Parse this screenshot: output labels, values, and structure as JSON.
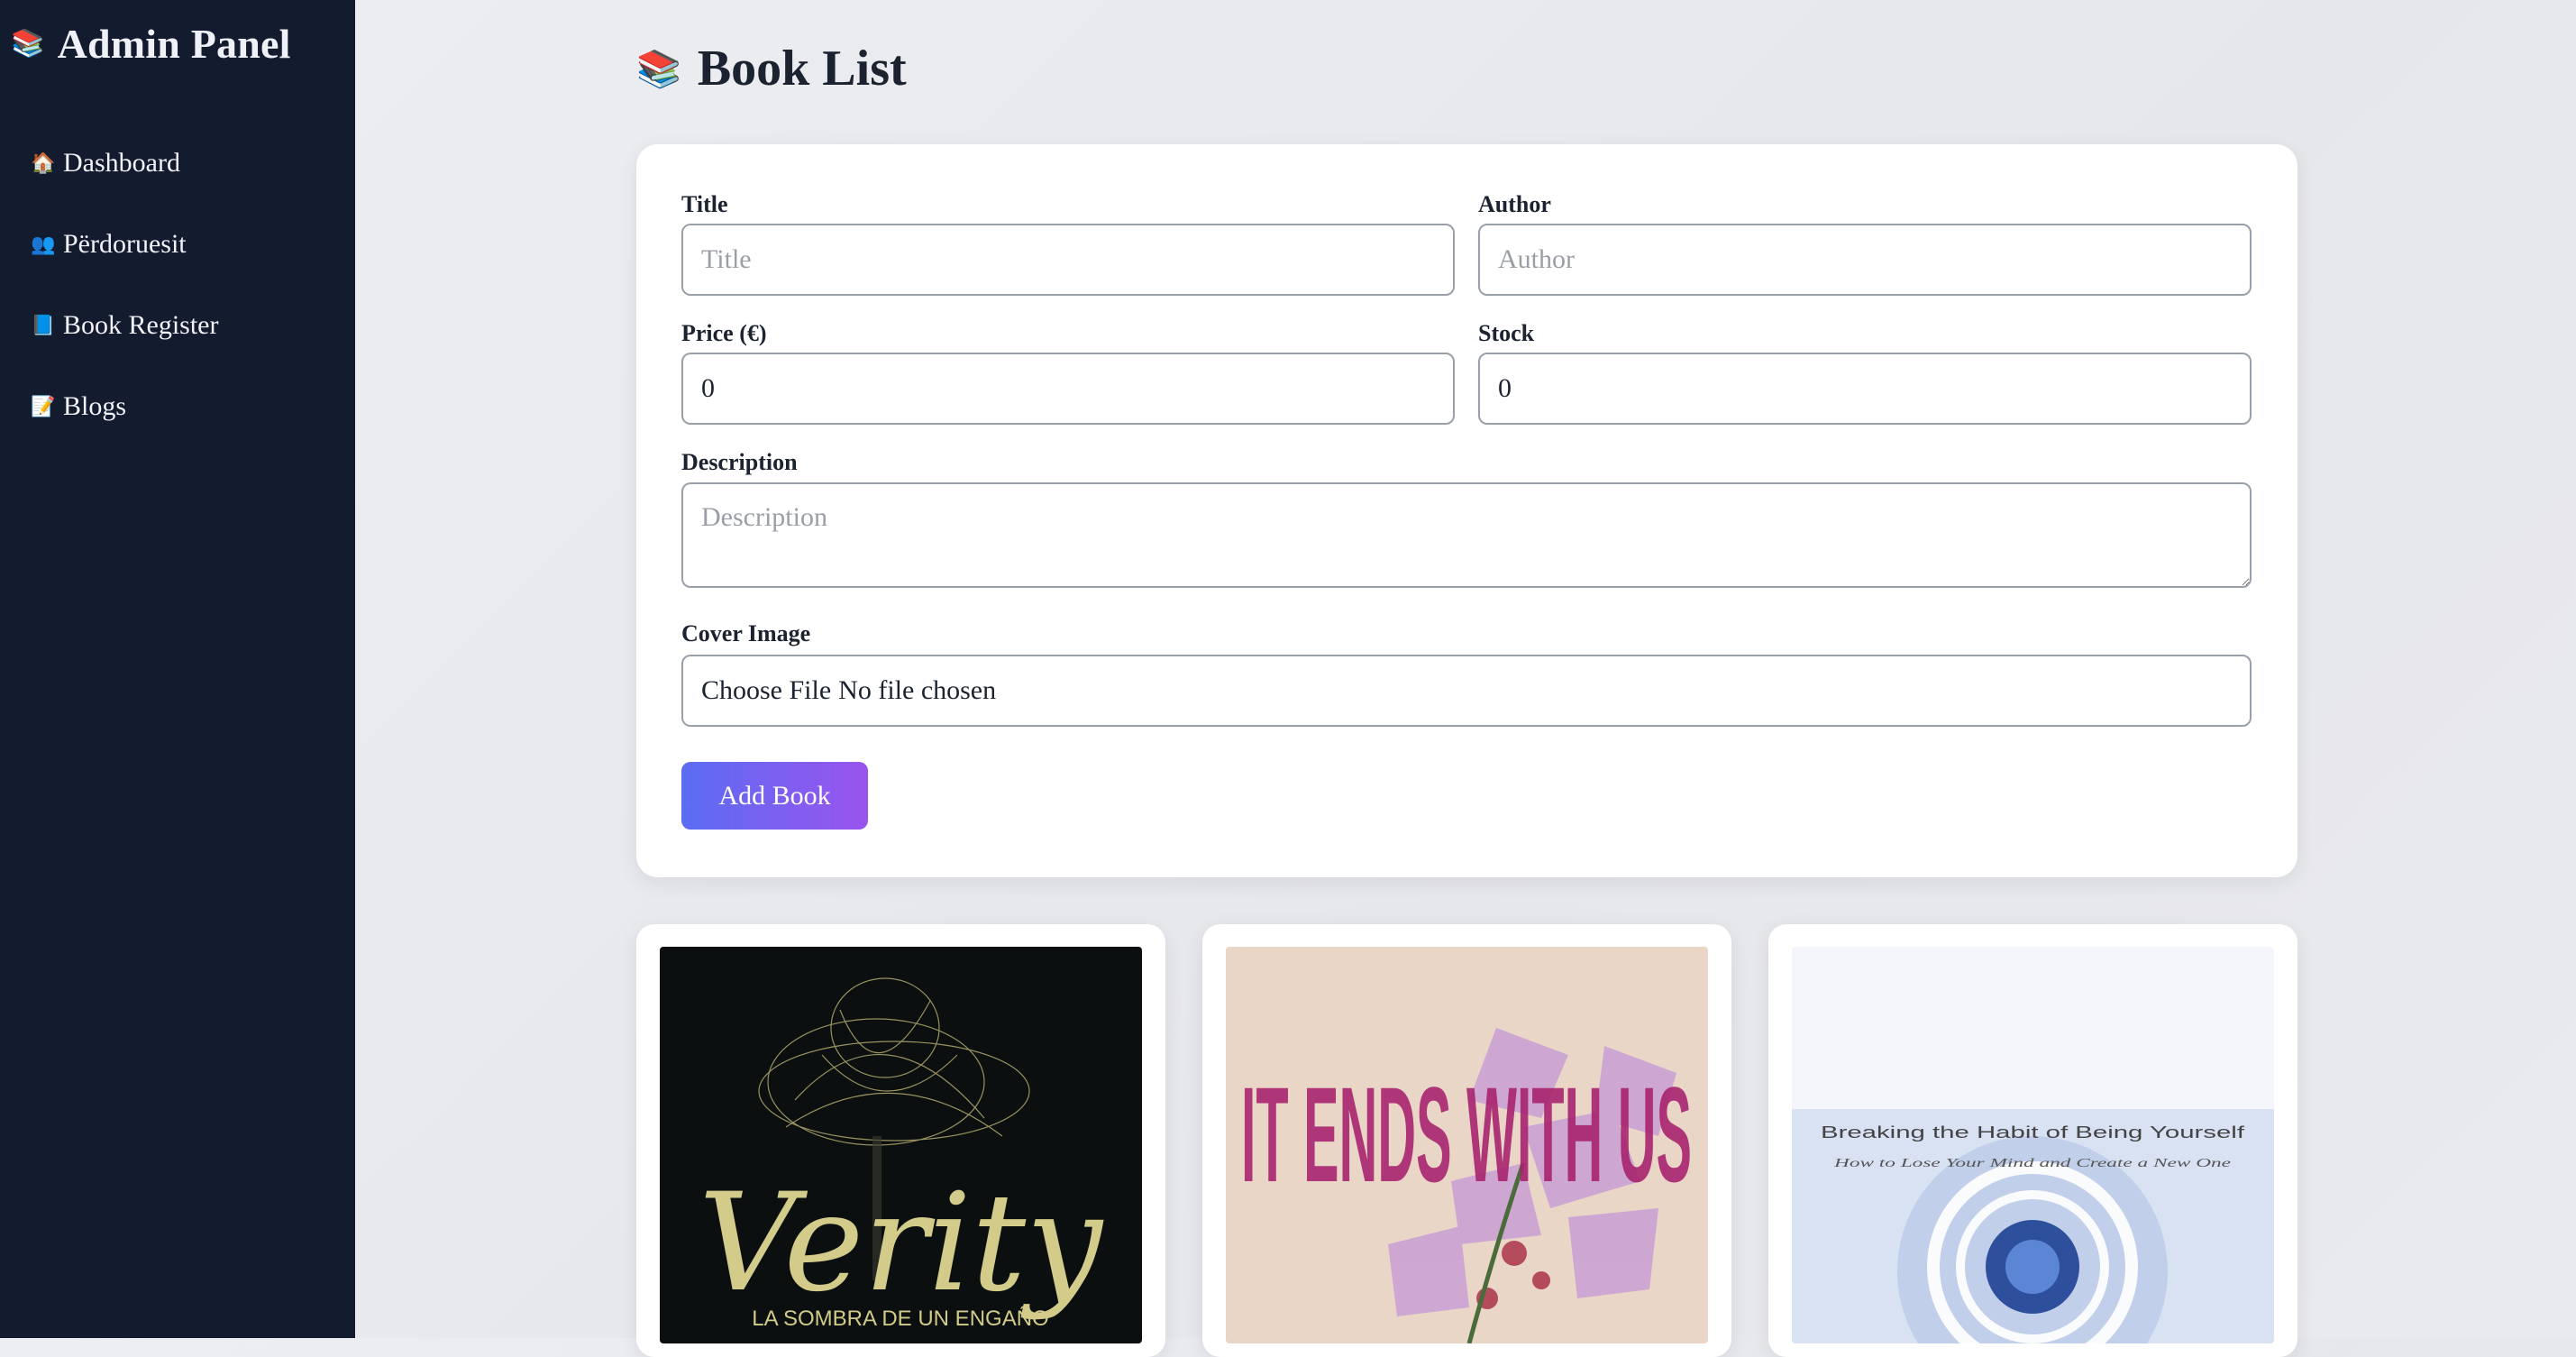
{
  "sidebar": {
    "brand_icon": "📚",
    "brand": "Admin Panel",
    "items": [
      {
        "icon": "🏠",
        "icon_name": "house-icon",
        "label": "Dashboard"
      },
      {
        "icon": "👥",
        "icon_name": "users-icon",
        "label": "Përdoruesit"
      },
      {
        "icon": "📘",
        "icon_name": "book-icon",
        "label": "Book Register"
      },
      {
        "icon": "📝",
        "icon_name": "memo-icon",
        "label": "Blogs"
      }
    ]
  },
  "page": {
    "title_icon": "📚",
    "title": "Book List"
  },
  "form": {
    "title_label": "Title",
    "title_placeholder": "Title",
    "author_label": "Author",
    "author_placeholder": "Author",
    "price_label": "Price (€)",
    "price_value": "0",
    "stock_label": "Stock",
    "stock_value": "0",
    "description_label": "Description",
    "description_placeholder": "Description",
    "cover_label": "Cover Image",
    "cover_button": "Choose File",
    "cover_status": "No file chosen",
    "submit_label": "Add Book"
  },
  "books": [
    {
      "cover_title": "Verity",
      "cover_subtitle": "LA SOMBRA DE UN ENGAÑO"
    },
    {
      "cover_title": "IT ENDS WITH US"
    },
    {
      "cover_title": "Breaking the Habit of Being Yourself",
      "cover_subtitle": "How to Lose Your Mind and Create a New One"
    }
  ],
  "colors": {
    "sidebar_bg": "#131b2e",
    "button_gradient_start": "#5b6cf3",
    "button_gradient_end": "#9a54ee"
  }
}
